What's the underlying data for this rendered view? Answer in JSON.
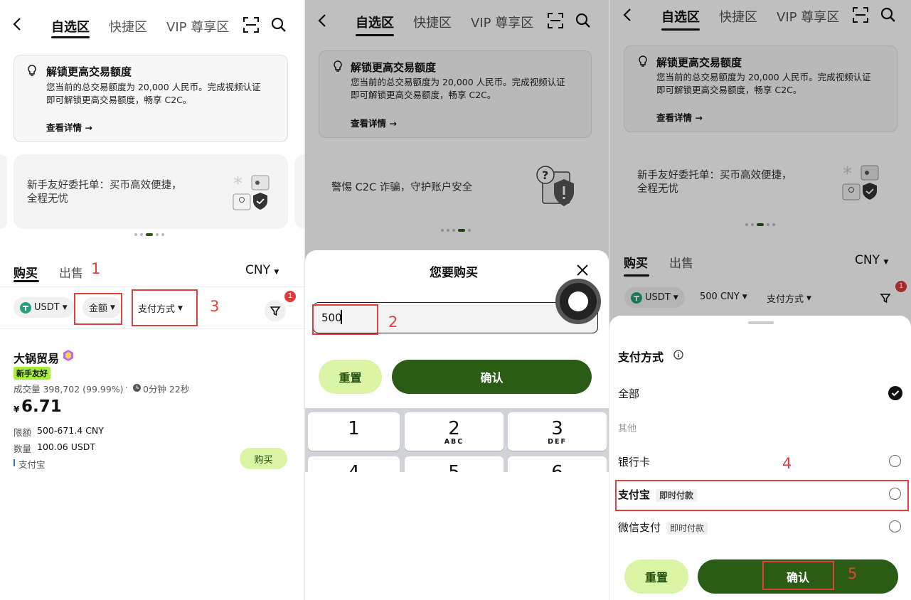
{
  "nav": {
    "tab_selected": "自选区",
    "tab_quick": "快捷区",
    "tab_vip": "VIP 尊享区"
  },
  "notice": {
    "title": "解锁更高交易额度",
    "line1": "您当前的总交易额度为 20,000 人民币。完成视频认证",
    "line2": "即可解锁更高交易额度，畅享 C2C。",
    "link": "查看详情 →"
  },
  "banners": {
    "newbie_line1": "新手友好委托单：买币高效便捷，",
    "newbie_line2": "全程无忧",
    "fraud": "警惕 C2C 诈骗，守护账户安全"
  },
  "trade": {
    "buy": "购买",
    "sell": "出售",
    "currency": "CNY"
  },
  "filters": {
    "coin": "USDT",
    "amount": "金额",
    "amount_selected": "500 CNY",
    "payment": "支付方式",
    "filter_badge": "1"
  },
  "listing": {
    "merchant": "大锅贸易",
    "badge": "新手友好",
    "volume_label": "成交量 398,702 (99.99%)",
    "sep": "·",
    "time": "0分钟 22秒",
    "currency_symbol": "¥",
    "price": "6.71",
    "limit_label": "限额",
    "limit_value": "500-671.4 CNY",
    "qty_label": "数量",
    "qty_value": "100.06 USDT",
    "pay_method": "支付宝",
    "buy_button": "购买"
  },
  "sheet_amount": {
    "title": "您要购买",
    "input_value": "500",
    "reset": "重置",
    "confirm": "确认"
  },
  "keypad": {
    "keys": [
      {
        "num": "1",
        "letters": ""
      },
      {
        "num": "2",
        "letters": "ABC"
      },
      {
        "num": "3",
        "letters": "DEF"
      },
      {
        "num": "4",
        "letters": ""
      },
      {
        "num": "5",
        "letters": ""
      },
      {
        "num": "6",
        "letters": ""
      }
    ]
  },
  "sheet_payment": {
    "title": "支付方式",
    "all": "全部",
    "other": "其他",
    "bank": "银行卡",
    "alipay": "支付宝",
    "alipay_tag": "即时付款",
    "wechat": "微信支付",
    "wechat_tag": "即时付款",
    "reset": "重置",
    "confirm": "确认"
  },
  "annotations": [
    "1",
    "2",
    "3",
    "4",
    "5"
  ],
  "colors": {
    "primary_green": "#2b5c16",
    "lime": "#dbf5a6",
    "annotation_red": "#e04040",
    "badge_red": "#e03b3b"
  }
}
